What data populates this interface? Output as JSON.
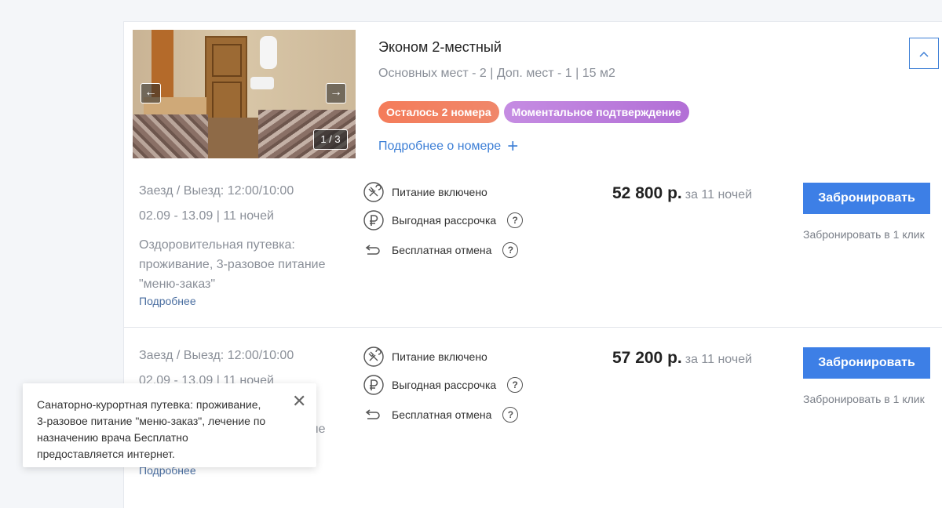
{
  "room": {
    "title": "Эконом 2-местный",
    "meta": "Основных мест - 2 | Доп. мест - 1 | 15 м2",
    "photo_counter": "1 / 3",
    "prev_arrow": "←",
    "next_arrow": "→",
    "badges": [
      {
        "label": "Осталось 2 номера",
        "color": "#f47c5a"
      },
      {
        "label": "Моментальное подтверждение",
        "color": "#b26fd6"
      }
    ],
    "more_link": "Подробнее о номере",
    "collapse_icon": "chevron-up-icon"
  },
  "offers": [
    {
      "checkin": "Заезд / Выезд: 12:00/10:00",
      "dates": "02.09  -  13.09 | 11 ночей",
      "description": "Оздоровительная путевка: проживание, 3-разовое питание \"меню-заказ\"",
      "details_link": "Подробнее",
      "features": [
        "Питание включено",
        "Выгодная рассрочка",
        "Бесплатная отмена"
      ],
      "price": "52 800 р.",
      "price_per": "за 11 ночей",
      "book_label": "Забронировать",
      "one_click": "Забронировать в 1 клик"
    },
    {
      "checkin": "Заезд / Выезд: 12:00/10:00",
      "dates": "02.09  -  13.09 | 11 ночей",
      "description": "Санаторно-курортная путевка: проживание, 3-разовое питание",
      "details_link": "Подробнее",
      "features": [
        "Питание включено",
        "Выгодная рассрочка",
        "Бесплатная отмена"
      ],
      "price": "57 200 р.",
      "price_per": "за 11 ночей",
      "book_label": "Забронировать",
      "one_click": "Забронировать в 1 клик"
    }
  ],
  "tooltip": {
    "text": "Санаторно-курортная путевка: проживание, 3-разовое питание \"меню-заказ\", лечение по назначению врача Бесплатно предоставляется интернет.",
    "close": "✕"
  },
  "colors": {
    "accent": "#3d7fe6",
    "link": "#3d7fd6",
    "muted_text": "#8a8f98"
  }
}
